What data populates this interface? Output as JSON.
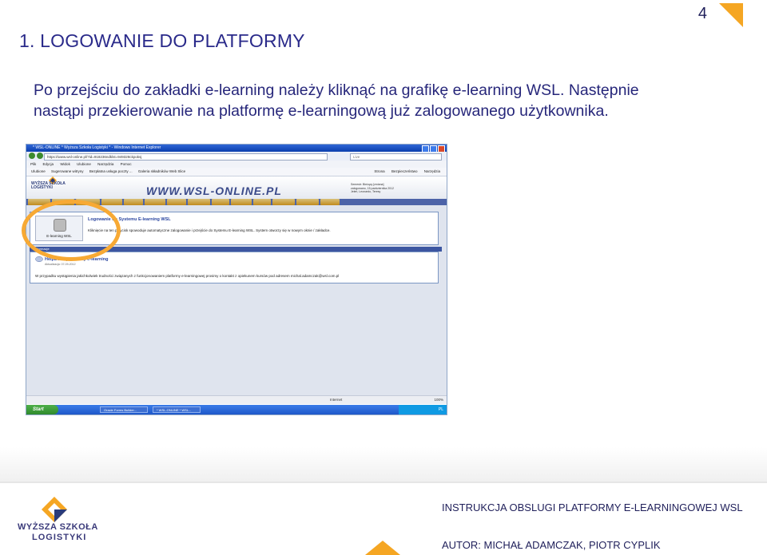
{
  "page_number": "4",
  "section_title": "1.   LOGOWANIE DO PLATFORMY",
  "intro": {
    "line1": "Po przejściu do zakładki e-learning należy kliknąć na grafikę e-learning WSL. Następnie",
    "line2": "nastąpi przekierowanie na platformę e-learningową już zalogowanego użytkownika."
  },
  "screenshot": {
    "window_title": "* WSL-ONLINE * Wyższa Szkoła Logistyki * - Windows Internet Explorer",
    "url": "https://www.wsl-online.pl/?id=918236ndklst=949328ckpoksj",
    "search_placeholder": "Live",
    "menu": [
      "Plik",
      "Edycja",
      "Widok",
      "Ulubione",
      "Narzędzia",
      "Pomoc"
    ],
    "favorites": [
      "Ulubione",
      "Sugerowane witryny",
      "Bezpłatna usługa poczty ...",
      "Galeria składników Web Slice"
    ],
    "toolbar_right": [
      "Strona",
      "Bezpieczeństwo",
      "Narzędzia"
    ],
    "logo_line1": "WYŻSZA SZKOŁA",
    "logo_line2": "LOGISTYKI",
    "banner": "WWW.WSL-ONLINE.PL",
    "user_info": [
      "Semestr: Bieżący [zmiana]",
      "zalogowano, 15 października 2012",
      "Jeleń, Leonardo, Teresy"
    ],
    "panel1_title": "Logowanie do Systemu E-learning WSL",
    "icon_label": "E-learning WSL",
    "panel1_text": "Kliknięcie na ten przycisk spowoduje automatyczne zalogowanie i przejście do Systemu E-learning WSL. System otworzy się w nowym oknie / zakładce.",
    "panel2_header": "Informacje",
    "panel2_title": "HelpDesk platformy e-learning",
    "panel2_date": "Aktualizacja: 07-09-2012",
    "panel2_text": "W przypadku wystąpienia jakichkolwiek trudności związanych z funkcjonowaniem platformy e-learningowej prosimy o kontakt z opiekunem kursów pod adresem michal.adamczak@wsl.com.pl",
    "status_zone": "Internet",
    "status_zoom": "100%",
    "start_label": "Start",
    "tasks": [
      "Oracle Forms Builder...",
      "* WSL-ONLINE * WSL..."
    ],
    "clock": "PL"
  },
  "footer": {
    "logo_line1": "WYŻSZA SZKOŁA",
    "logo_line2": "LOGISTYKI",
    "doc_title": "INSTRUKCJA OBSLUGI PLATFORMY E-LEARNINGOWEJ WSL",
    "authors": "AUTOR: MICHAŁ ADAMCZAK, PIOTR CYPLIK"
  },
  "colors": {
    "accent": "#f5a623",
    "text": "#1f1f5a",
    "highlight_ring": "#f7a934"
  }
}
